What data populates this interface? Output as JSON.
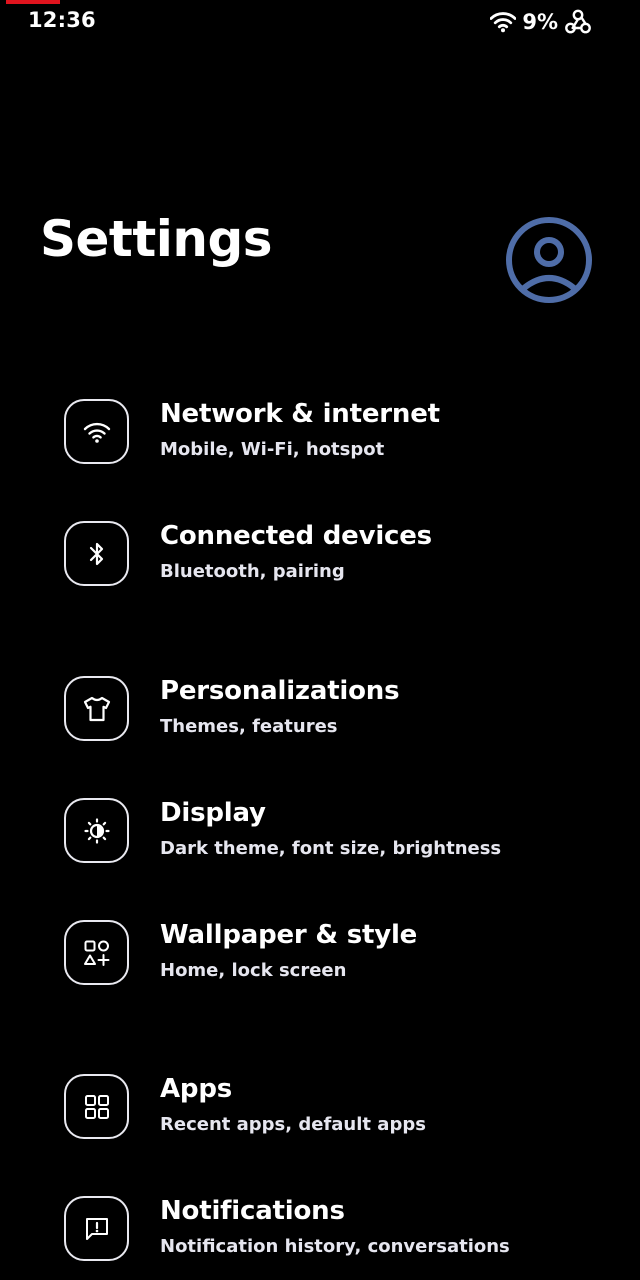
{
  "status_bar": {
    "time": "12:36",
    "battery": "9%"
  },
  "header": {
    "title": "Settings"
  },
  "colors": {
    "background": "#000000",
    "text": "#ffffff",
    "accent": "#4f6da8",
    "recording_indicator": "#e0141e"
  },
  "items": [
    {
      "title": "Network & internet",
      "subtitle": "Mobile, Wi-Fi, hotspot",
      "icon": "wifi-icon"
    },
    {
      "title": "Connected devices",
      "subtitle": "Bluetooth, pairing",
      "icon": "bluetooth-icon"
    },
    {
      "title": "Personalizations",
      "subtitle": "Themes, features",
      "icon": "tshirt-icon"
    },
    {
      "title": "Display",
      "subtitle": "Dark theme, font size, brightness",
      "icon": "brightness-icon"
    },
    {
      "title": "Wallpaper & style",
      "subtitle": "Home, lock screen",
      "icon": "shapes-icon"
    },
    {
      "title": "Apps",
      "subtitle": "Recent apps, default apps",
      "icon": "apps-grid-icon"
    },
    {
      "title": "Notifications",
      "subtitle": "Notification history, conversations",
      "icon": "notification-icon"
    }
  ]
}
